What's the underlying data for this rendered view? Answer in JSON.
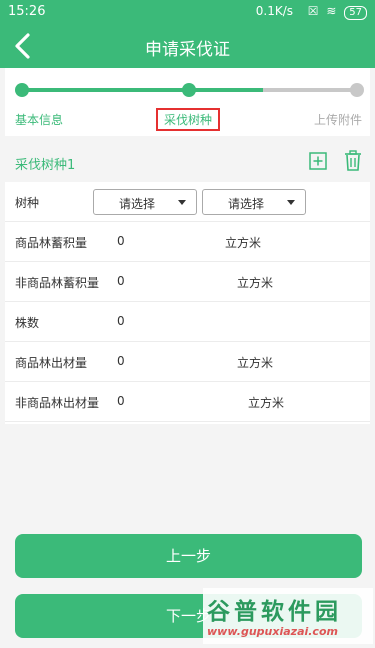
{
  "status_bar": {
    "time": "15:26",
    "speed": "0.1K/s",
    "icons": "☒ ≋",
    "battery": "57"
  },
  "header": {
    "title": "申请采伐证",
    "back_icon": "chevron-left-icon"
  },
  "steps": {
    "current": 2,
    "items": [
      {
        "label": "基本信息",
        "state": "done"
      },
      {
        "label": "采伐树种",
        "state": "current"
      },
      {
        "label": "上传附件",
        "state": "todo"
      }
    ]
  },
  "section": {
    "title": "采伐树种1",
    "add_icon": "plus-square-icon",
    "delete_icon": "trash-icon"
  },
  "form": {
    "species": {
      "label": "树种",
      "select1": "请选择",
      "select2": "请选择"
    },
    "rows": [
      {
        "label": "商品林蓄积量",
        "value": "0",
        "unit": "立方米"
      },
      {
        "label": "非商品林蓄积量",
        "value": "0",
        "unit": "立方米"
      },
      {
        "label": "株数",
        "value": "0",
        "unit": ""
      },
      {
        "label": "商品林出材量",
        "value": "0",
        "unit": "立方米"
      },
      {
        "label": "非商品林出材量",
        "value": "0",
        "unit": "立方米"
      }
    ]
  },
  "buttons": {
    "prev": "上一步",
    "next": "下一步"
  },
  "watermark": {
    "title": "谷普软件园",
    "url": "www.gupuxiazai.com"
  },
  "colors": {
    "accent": "#3bba79",
    "highlight_border": "#e53030",
    "inactive": "#c8c8c8"
  }
}
